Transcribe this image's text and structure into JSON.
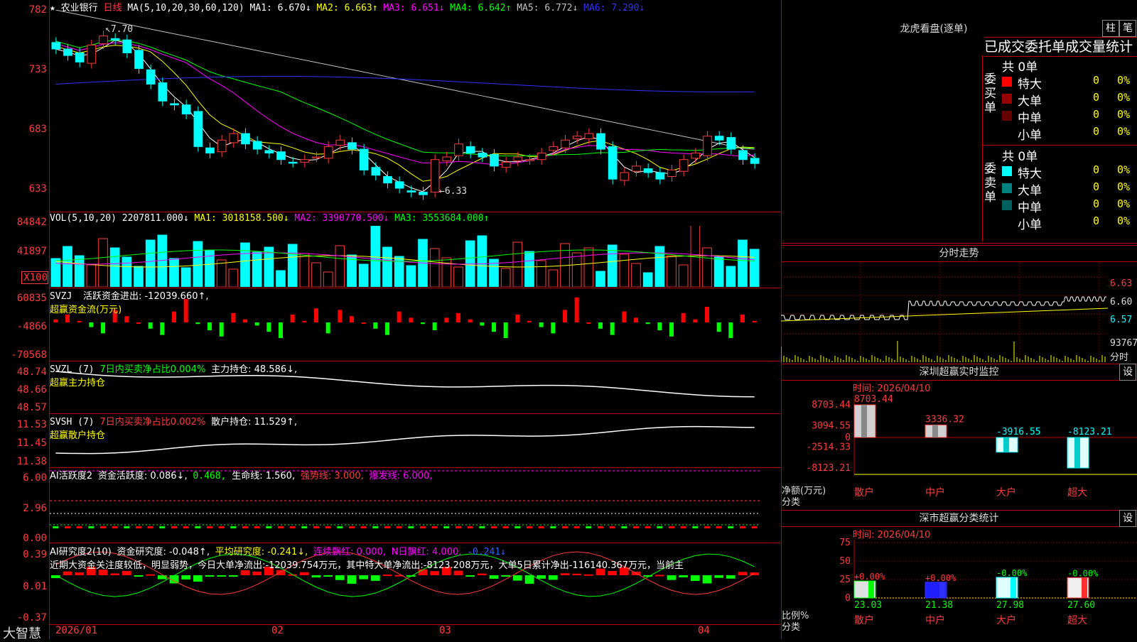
{
  "stock": {
    "star": "★",
    "name": "农业银行",
    "period": "日线"
  },
  "ma_line": {
    "label": "MA(5,10,20,30,60,120)",
    "items": [
      {
        "label": "MA1: 6.670↓",
        "color": "#ffffff"
      },
      {
        "label": "MA2: 6.663↑",
        "color": "#ffff00"
      },
      {
        "label": "MA3: 6.651↓",
        "color": "#ff00ff"
      },
      {
        "label": "MA4: 6.642↑",
        "color": "#00ff00"
      },
      {
        "label": "MA5: 6.772↓",
        "color": "#c0c0c0"
      },
      {
        "label": "MA6: 7.290↓",
        "color": "#3030ff"
      }
    ]
  },
  "price_axis": [
    "782",
    "733",
    "683",
    "633"
  ],
  "price_annotations": {
    "high": "7.70",
    "low": "6.33"
  },
  "vol": {
    "label": "VOL(5,10,20)",
    "value": "2207811.000↓",
    "ma1": "MA1: 3018158.500↓",
    "ma2": "MA2: 3390770.500↓",
    "ma3": "MA3: 3553684.000↑",
    "axis": [
      "84842",
      "41897",
      "X100"
    ]
  },
  "svzj": {
    "name": "SVZJ",
    "l1": "活跃资金进出: -12039.660↑,",
    "l2": "超赢资金流(万元)",
    "axis": [
      "60835",
      "-4866",
      "-70568"
    ]
  },
  "svzl": {
    "name": "SVZL (7)",
    "l1": "7日内买卖净占比0.004%",
    "l2": "主力持仓: 48.586↓,",
    "l3": "超赢主力持仓",
    "axis": [
      "48.74",
      "48.66",
      "48.57"
    ]
  },
  "svsh": {
    "name": "SVSH (7)",
    "l1": "7日内买卖净占比0.002%",
    "l2": "散户持仓: 11.529↑,",
    "l3": "超赢散户持仓",
    "axis": [
      "11.53",
      "11.45",
      "11.38"
    ]
  },
  "ai1": {
    "name": "AI活跃度2",
    "l1": "资金活跃度: 0.086↓,",
    "l2": "0.468,",
    "l3": "生命线: 1.560,",
    "l4": "强势线: 3.000,",
    "l5": "爆发线: 6.000,",
    "axis": [
      "6.00",
      "2.96",
      "0.00"
    ]
  },
  "ai2": {
    "name": "AI研究度2(10)",
    "l1": "资金研究度: -0.048↑,",
    "l2": "平均研究度: -0.241↓,",
    "l3": "连续飘红: 0.000,",
    "l4": "N日飘红: 4.000,",
    "l5": "-0.241↓",
    "note": "近期大资金关注度较低，明显弱势，今日大单净流出:-12039.754万元，其中特大单净流出:-8123.208万元，大单5日累计净出-116140.367万元，当前主",
    "axis": [
      "0.39",
      "0.01",
      "-0.37"
    ]
  },
  "dates": [
    "2026/01",
    "02",
    "03",
    "04"
  ],
  "logo": "大智慧",
  "right": {
    "lhkp": {
      "title": "龙虎看盘(逐单)",
      "btn1": "柱",
      "btn2": "笔",
      "tabs": "已成交委托单成交量统计",
      "buy": {
        "side": "委买单",
        "total": "共 0单",
        "rows": [
          {
            "n": "特大",
            "v": "0",
            "p": "0%",
            "c": "#ff0000"
          },
          {
            "n": "大单",
            "v": "0",
            "p": "0%",
            "c": "#990000"
          },
          {
            "n": "中单",
            "v": "0",
            "p": "0%",
            "c": "#660000"
          },
          {
            "n": "小单",
            "v": "0",
            "p": "0%",
            "c": "#000000"
          }
        ]
      },
      "sell": {
        "side": "委卖单",
        "total": "共 0单",
        "rows": [
          {
            "n": "特大",
            "v": "0",
            "p": "0%",
            "c": "#00ffff"
          },
          {
            "n": "大单",
            "v": "0",
            "p": "0%",
            "c": "#008080"
          },
          {
            "n": "中单",
            "v": "0",
            "p": "0%",
            "c": "#006060"
          },
          {
            "n": "小单",
            "v": "0",
            "p": "0%",
            "c": "#000000"
          }
        ]
      }
    },
    "fenshi": {
      "title": "分时走势",
      "axis": [
        "6.63",
        "6.60",
        "6.57"
      ],
      "vol": "93767",
      "unit": "分时"
    },
    "szcy": {
      "title": "深圳超赢实时监控",
      "btn": "设",
      "time": "时间: 2026/04/10",
      "axis": [
        "8703.44",
        "3094.55",
        "0",
        "-2514.33",
        "-8123.21"
      ],
      "ylab1": "净额(万元)",
      "ylab2": "分类",
      "bars": [
        {
          "cat": "散户",
          "val": "8703.44",
          "num": 8703.44
        },
        {
          "cat": "中户",
          "val": "3336.32",
          "num": 3336.32
        },
        {
          "cat": "大户",
          "val": "-3916.55",
          "num": -3916.55
        },
        {
          "cat": "超大",
          "val": "-8123.21",
          "num": -8123.21
        }
      ]
    },
    "sscl": {
      "title": "深市超赢分类统计",
      "btn": "设",
      "time": "时间: 2026/04/10",
      "axis": [
        "75",
        "50",
        "25",
        "0"
      ],
      "ylab1": "比例%",
      "ylab2": "分类",
      "bars": [
        {
          "cat": "散户",
          "val": "23.03",
          "num": 23.03,
          "chg": "+0.00%"
        },
        {
          "cat": "中户",
          "val": "21.38",
          "num": 21.38,
          "chg": "+0.00%"
        },
        {
          "cat": "大户",
          "val": "27.98",
          "num": 27.98,
          "chg": "-0.00%"
        },
        {
          "cat": "超大",
          "val": "27.60",
          "num": 27.6,
          "chg": "-0.00%"
        }
      ]
    }
  },
  "chart_data": [
    {
      "type": "candlestick",
      "title": "农业银行 日线",
      "ylim": [
        630,
        790
      ],
      "ma_colors": [
        "#ffffff",
        "#ffff00",
        "#ff00ff",
        "#00ff00",
        "#c0c0c0",
        "#3030ff"
      ],
      "close": [
        7.55,
        7.5,
        7.45,
        7.58,
        7.65,
        7.62,
        7.52,
        7.4,
        7.28,
        7.15,
        7.12,
        7.05,
        6.8,
        6.75,
        6.85,
        6.9,
        6.82,
        6.78,
        6.75,
        6.7,
        6.68,
        6.7,
        6.72,
        6.8,
        6.85,
        6.78,
        6.62,
        6.58,
        6.52,
        6.48,
        6.45,
        6.43,
        6.7,
        6.72,
        6.82,
        6.75,
        6.72,
        6.65,
        6.68,
        6.72,
        6.7,
        6.75,
        6.8,
        6.85,
        6.88,
        6.9,
        6.78,
        6.55,
        6.6,
        6.65,
        6.6,
        6.55,
        6.62,
        6.7,
        6.75,
        6.88,
        6.85,
        6.78,
        6.7,
        6.67
      ]
    }
  ]
}
